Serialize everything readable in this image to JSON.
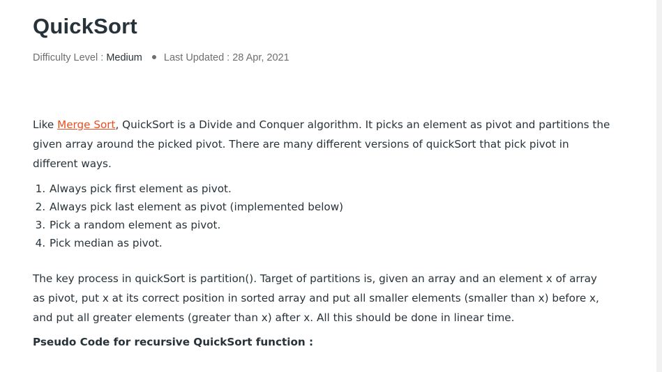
{
  "article": {
    "title": "QuickSort",
    "meta": {
      "difficulty_label": "Difficulty Level : ",
      "difficulty_value": "Medium",
      "updated_label": "Last Updated : ",
      "updated_value": "28 Apr, 2021"
    },
    "intro": {
      "before_link": "Like ",
      "link_text": "Merge Sort",
      "after_link": ", QuickSort is a Divide and Conquer algorithm. It picks an element as pivot and partitions the given array around the picked pivot. There are many different versions of quickSort that pick pivot in different ways."
    },
    "methods": [
      "Always pick first element as pivot.",
      "Always pick last element as pivot (implemented below)",
      "Pick a random element as pivot.",
      "Pick median as pivot."
    ],
    "partition_paragraph": "The key process in quickSort is partition(). Target of partitions is, given an array and an element x of array as pivot, put x at its correct position in sorted array and put all smaller elements (smaller than x) before x, and put all greater elements (greater than x) after x. All this should be done in linear time.",
    "pseudo_heading": "Pseudo Code for recursive QuickSort function :"
  },
  "colors": {
    "text": "#273239",
    "link": "#ec4e20",
    "muted": "#6e6e6e"
  }
}
